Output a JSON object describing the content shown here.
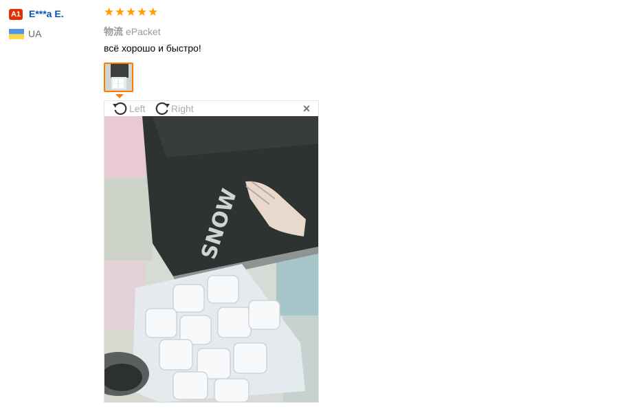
{
  "user": {
    "level_badge": "A1",
    "name": "E***a E.",
    "country": "UA",
    "flag_icon": "ukraine-flag-icon"
  },
  "review": {
    "rating": 5,
    "rating_max": 5,
    "logistics_label": "物流",
    "logistics_value": "ePacket",
    "text": "всё хорошо и быстро!",
    "photo_count": 1
  },
  "viewer": {
    "rotate_left_label": "Left",
    "rotate_right_label": "Right",
    "close_icon": "close-icon",
    "image_text": "SNOW"
  },
  "colors": {
    "accent": "#ff7a00",
    "star": "#ff9a00",
    "link": "#0654ba",
    "badge": "#e62e04"
  }
}
